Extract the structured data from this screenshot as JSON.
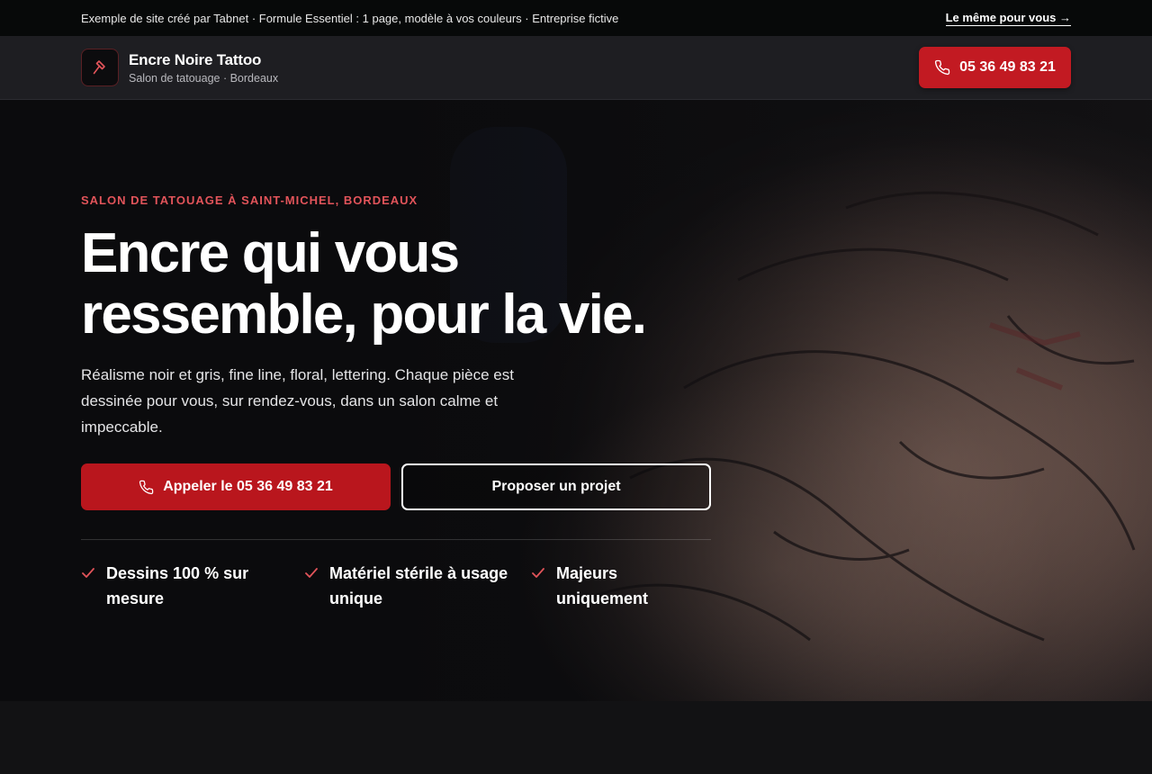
{
  "topbar": {
    "notice": "Exemple de site créé par Tabnet · Formule Essentiel : 1 page, modèle à vos couleurs · Entreprise fictive",
    "link_label": "Le même pour vous →"
  },
  "header": {
    "brand_name": "Encre Noire Tattoo",
    "brand_sub": "Salon de tatouage · Bordeaux",
    "logo_icon": "tattoo-machine-icon",
    "call_label": "05 36 49 83 21",
    "call_icon": "phone-icon"
  },
  "hero": {
    "eyebrow": "SALON DE TATOUAGE À SAINT-MICHEL, BORDEAUX",
    "title_line1": "Encre qui vous",
    "title_line2": "ressemble, pour la vie.",
    "lead": "Réalisme noir et gris, fine line, floral, lettering. Chaque pièce est dessinée pour vous, sur rendez-vous, dans un salon calme et impeccable.",
    "cta_primary": "Appeler le 05 36 49 83 21",
    "cta_secondary": "Proposer un projet",
    "features": [
      {
        "label": "Dessins 100 % sur mesure",
        "icon": "check-icon"
      },
      {
        "label": "Matériel stérile à usage unique",
        "icon": "check-icon"
      },
      {
        "label": "Majeurs uniquement",
        "icon": "check-icon"
      }
    ]
  },
  "colors": {
    "accent": "#c21a22",
    "eyebrow": "#e2545a",
    "topbar_bg": "#070909",
    "header_bg": "#1e1e22",
    "page_bg": "#121214"
  }
}
